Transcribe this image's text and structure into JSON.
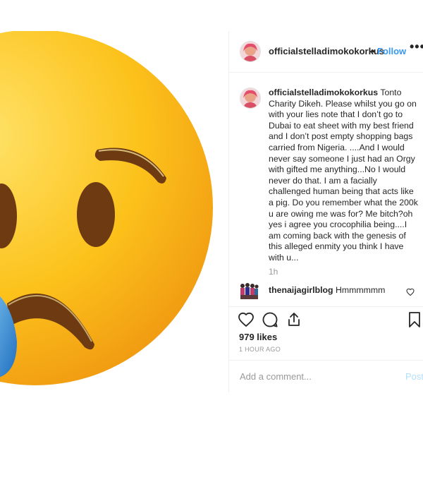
{
  "post": {
    "username": "officialstelladimokokorkus",
    "follow_label": "Follow",
    "separator": "•",
    "more_label": "•••",
    "media_icon": "sad-face-emoji-icon",
    "caption": {
      "username": "officialstelladimokokorkus",
      "text": "Tonto Charity Dikeh. Please whilst you go on with your lies note that I don’t go to Dubai to eat sheet with my best friend and I don’t post empty shopping bags carried from Nigeria. ....And I would never say someone I just had an Orgy with gifted me anything...No I would never do that. I am a facially challenged human being that acts like a pig. Do you remember what the 200k u are owing me was for? Me bitch?oh yes i agree you crocophilia being....I am coming back with the genesis of this alleged enmity you think I have with u...",
      "time": "1h"
    },
    "comments": [
      {
        "username": "thenaijagirlblog",
        "text": "Hmmmmmm"
      }
    ],
    "likes": "979 likes",
    "time_ago": "1 HOUR AGO",
    "add_comment_placeholder": "Add a comment...",
    "post_label": "Post"
  },
  "colors": {
    "link": "#3897f0",
    "post_disabled": "#b2dffc",
    "muted": "#999999"
  }
}
